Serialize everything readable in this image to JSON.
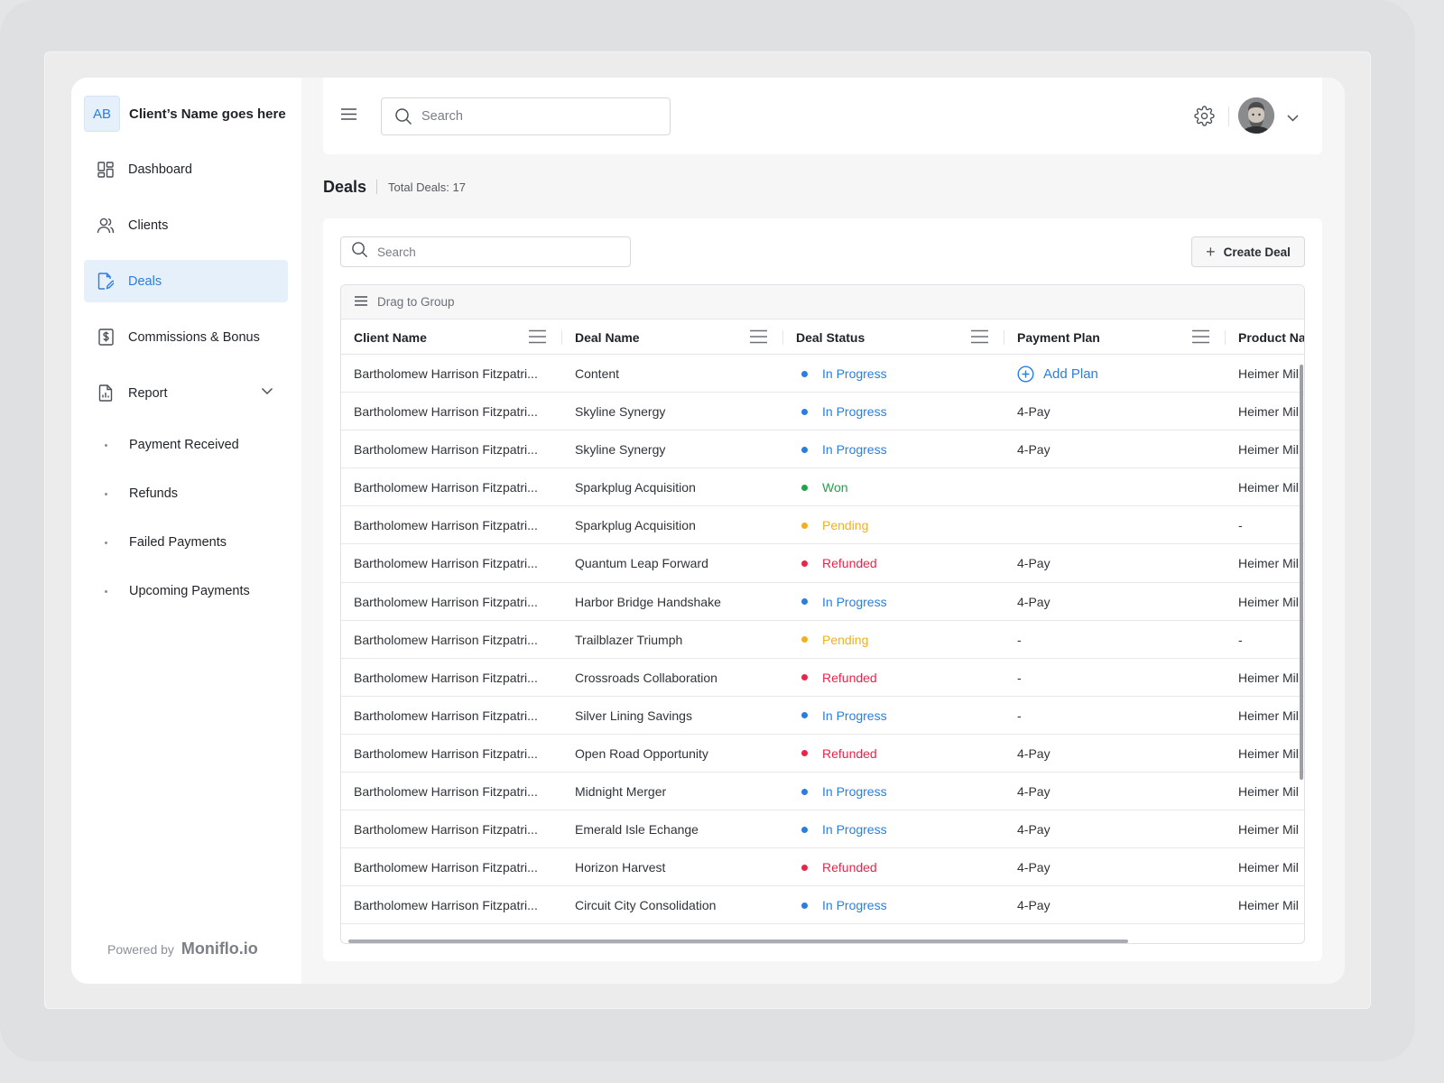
{
  "brand": {
    "initials": "AB",
    "name": "Client’s Name goes here"
  },
  "sidebar": {
    "items": [
      {
        "label": "Dashboard",
        "icon": "dashboard-icon"
      },
      {
        "label": "Clients",
        "icon": "users-icon"
      },
      {
        "label": "Deals",
        "icon": "deals-icon",
        "active": true
      },
      {
        "label": "Commissions & Bonus",
        "icon": "dollar-doc-icon"
      },
      {
        "label": "Report",
        "icon": "report-icon",
        "expanded": true
      }
    ],
    "report_subitems": [
      "Payment Received",
      "Refunds",
      "Failed Payments",
      "Upcoming Payments"
    ],
    "powered_by": "Powered by",
    "powered_logo": "Moniflo.io"
  },
  "topbar": {
    "search_placeholder": "Search"
  },
  "page": {
    "title": "Deals",
    "total": "Total Deals: 17"
  },
  "toolbar": {
    "search_placeholder": "Search",
    "create_label": "Create Deal"
  },
  "grid": {
    "group_label": "Drag to Group",
    "columns": [
      "Client Name",
      "Deal Name",
      "Deal Status",
      "Payment Plan",
      "Product Na"
    ],
    "status_colors": {
      "In Progress": "#2b7de0",
      "Won": "#22a34a",
      "Pending": "#f2b01e",
      "Refunded": "#e8264a"
    },
    "add_plan_label": "Add Plan",
    "rows": [
      {
        "client": "Bartholomew Harrison Fitzpatri...",
        "deal": "Content",
        "status": "In Progress",
        "plan": "",
        "add_plan": true,
        "product": "Heimer Mil"
      },
      {
        "client": "Bartholomew Harrison Fitzpatri...",
        "deal": "Skyline Synergy",
        "status": "In Progress",
        "plan": "4-Pay",
        "product": "Heimer Mil"
      },
      {
        "client": "Bartholomew Harrison Fitzpatri...",
        "deal": "Skyline Synergy",
        "status": "In Progress",
        "plan": "4-Pay",
        "product": "Heimer Mil"
      },
      {
        "client": "Bartholomew Harrison Fitzpatri...",
        "deal": "Sparkplug Acquisition",
        "status": "Won",
        "plan": "",
        "product": "Heimer Mil"
      },
      {
        "client": "Bartholomew Harrison Fitzpatri...",
        "deal": "Sparkplug Acquisition",
        "status": "Pending",
        "plan": "",
        "product": "-"
      },
      {
        "client": "Bartholomew Harrison Fitzpatri...",
        "deal": "Quantum Leap Forward",
        "status": "Refunded",
        "plan": "4-Pay",
        "product": "Heimer Mil"
      },
      {
        "client": "Bartholomew Harrison Fitzpatri...",
        "deal": "Harbor Bridge Handshake",
        "status": "In Progress",
        "plan": "4-Pay",
        "product": "Heimer Mil"
      },
      {
        "client": "Bartholomew Harrison Fitzpatri...",
        "deal": "Trailblazer Triumph",
        "status": "Pending",
        "plan": "-",
        "product": "-"
      },
      {
        "client": "Bartholomew Harrison Fitzpatri...",
        "deal": "Crossroads Collaboration",
        "status": "Refunded",
        "plan": "-",
        "product": "Heimer Mil"
      },
      {
        "client": "Bartholomew Harrison Fitzpatri...",
        "deal": "Silver Lining Savings",
        "status": "In Progress",
        "plan": "-",
        "product": "Heimer Mil"
      },
      {
        "client": "Bartholomew Harrison Fitzpatri...",
        "deal": "Open Road Opportunity",
        "status": "Refunded",
        "plan": "4-Pay",
        "product": "Heimer Mil"
      },
      {
        "client": "Bartholomew Harrison Fitzpatri...",
        "deal": "Midnight Merger",
        "status": "In Progress",
        "plan": "4-Pay",
        "product": "Heimer Mil"
      },
      {
        "client": "Bartholomew Harrison Fitzpatri...",
        "deal": "Emerald Isle Echange",
        "status": "In Progress",
        "plan": "4-Pay",
        "product": "Heimer Mil"
      },
      {
        "client": "Bartholomew Harrison Fitzpatri...",
        "deal": "Horizon Harvest",
        "status": "Refunded",
        "plan": "4-Pay",
        "product": "Heimer Mil"
      },
      {
        "client": "Bartholomew Harrison Fitzpatri...",
        "deal": "Circuit City Consolidation",
        "status": "In Progress",
        "plan": "4-Pay",
        "product": "Heimer Mil"
      }
    ]
  }
}
